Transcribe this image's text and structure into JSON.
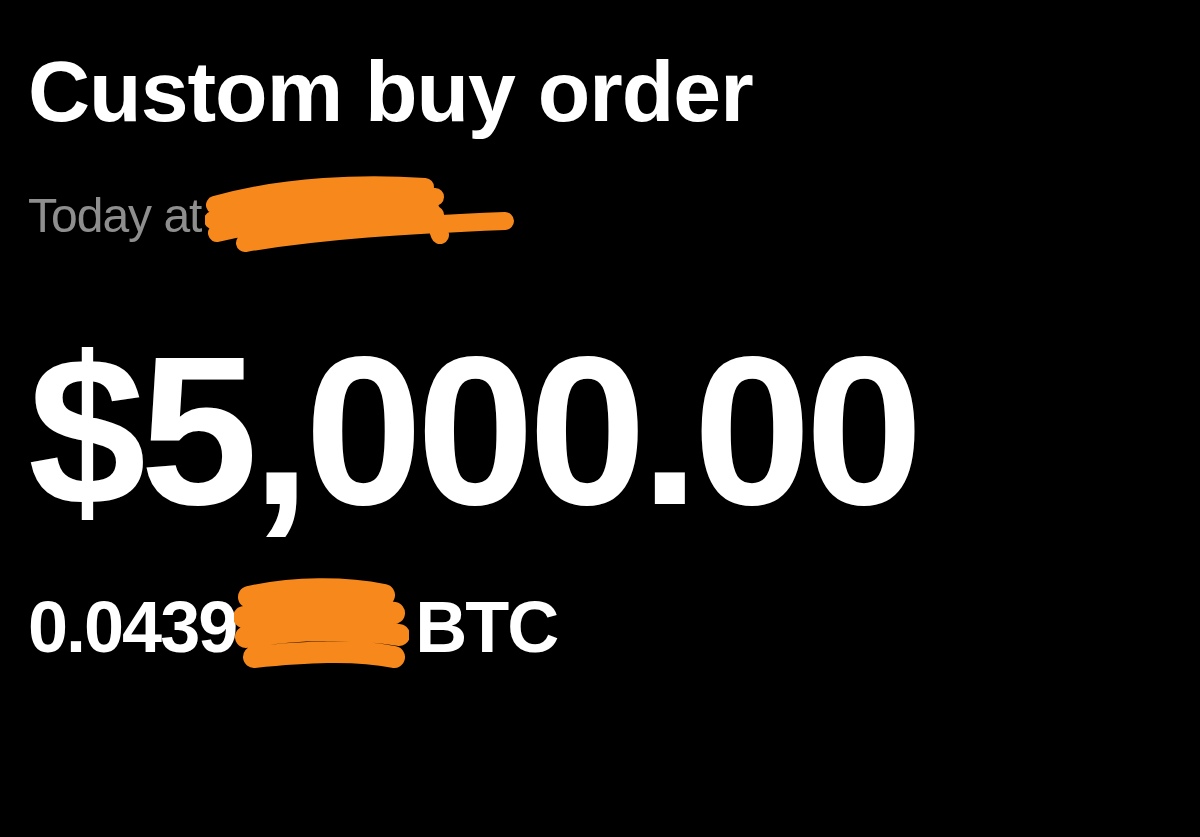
{
  "order": {
    "title": "Custom buy order",
    "time_label": "Today at",
    "time_redacted": true
  },
  "amount": {
    "fiat": "$5,000.00",
    "crypto_prefix": "0.0439",
    "crypto_redacted": true,
    "crypto_unit": "BTC"
  }
}
